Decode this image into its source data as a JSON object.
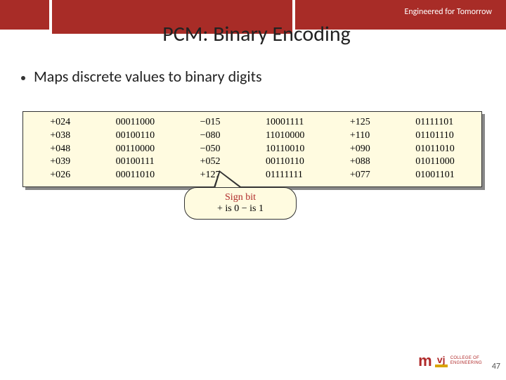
{
  "tagline": "Engineered for Tomorrow",
  "title": "PCM: Binary Encoding",
  "bullet": "Maps discrete values to binary digits",
  "table": {
    "col1": [
      "+024",
      "+038",
      "+048",
      "+039",
      "+026"
    ],
    "col2": [
      "00011000",
      "00100110",
      "00110000",
      "00100111",
      "00011010"
    ],
    "col3": [
      "−015",
      "−080",
      "−050",
      "+052",
      "+127"
    ],
    "col4": [
      "10001111",
      "11010000",
      "10110010",
      "00110110",
      "01111111"
    ],
    "col5": [
      "+125",
      "+110",
      "+090",
      "+088",
      "+077"
    ],
    "col6": [
      "01111101",
      "01101110",
      "01011010",
      "01011000",
      "01001101"
    ]
  },
  "callout": {
    "line1": "Sign bit",
    "line2": "+ is 0   − is 1"
  },
  "logo": {
    "m": "m",
    "vj": "vj",
    "line1": "COLLEGE OF",
    "line2": "ENGINEERING"
  },
  "pagenum": "47"
}
